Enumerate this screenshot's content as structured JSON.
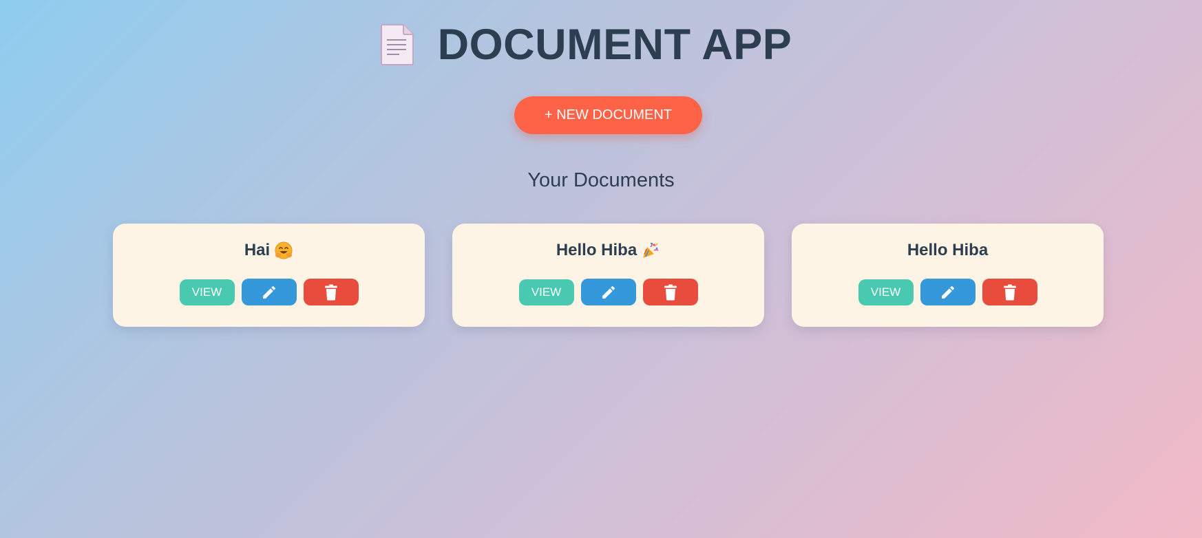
{
  "app": {
    "title": "DOCUMENT APP",
    "icon": "document-icon"
  },
  "toolbar": {
    "new_document_label": "+ NEW DOCUMENT",
    "accent_color": "#ff6347"
  },
  "documents_section": {
    "heading": "Your Documents"
  },
  "documents": [
    {
      "title": "Hai",
      "emoji": "hugging-face-emoji",
      "view_label": "VIEW",
      "edit_icon": "pencil-icon",
      "delete_icon": "trash-icon"
    },
    {
      "title": "Hello Hiba",
      "emoji": "party-popper-emoji",
      "view_label": "VIEW",
      "edit_icon": "pencil-icon",
      "delete_icon": "trash-icon"
    },
    {
      "title": "Hello Hiba",
      "emoji": "",
      "view_label": "VIEW",
      "edit_icon": "pencil-icon",
      "delete_icon": "trash-icon"
    }
  ],
  "colors": {
    "view": "#48c9b0",
    "edit": "#3498db",
    "delete": "#e74c3c",
    "card_bg": "#fdf4e5",
    "text": "#2c3e50"
  }
}
